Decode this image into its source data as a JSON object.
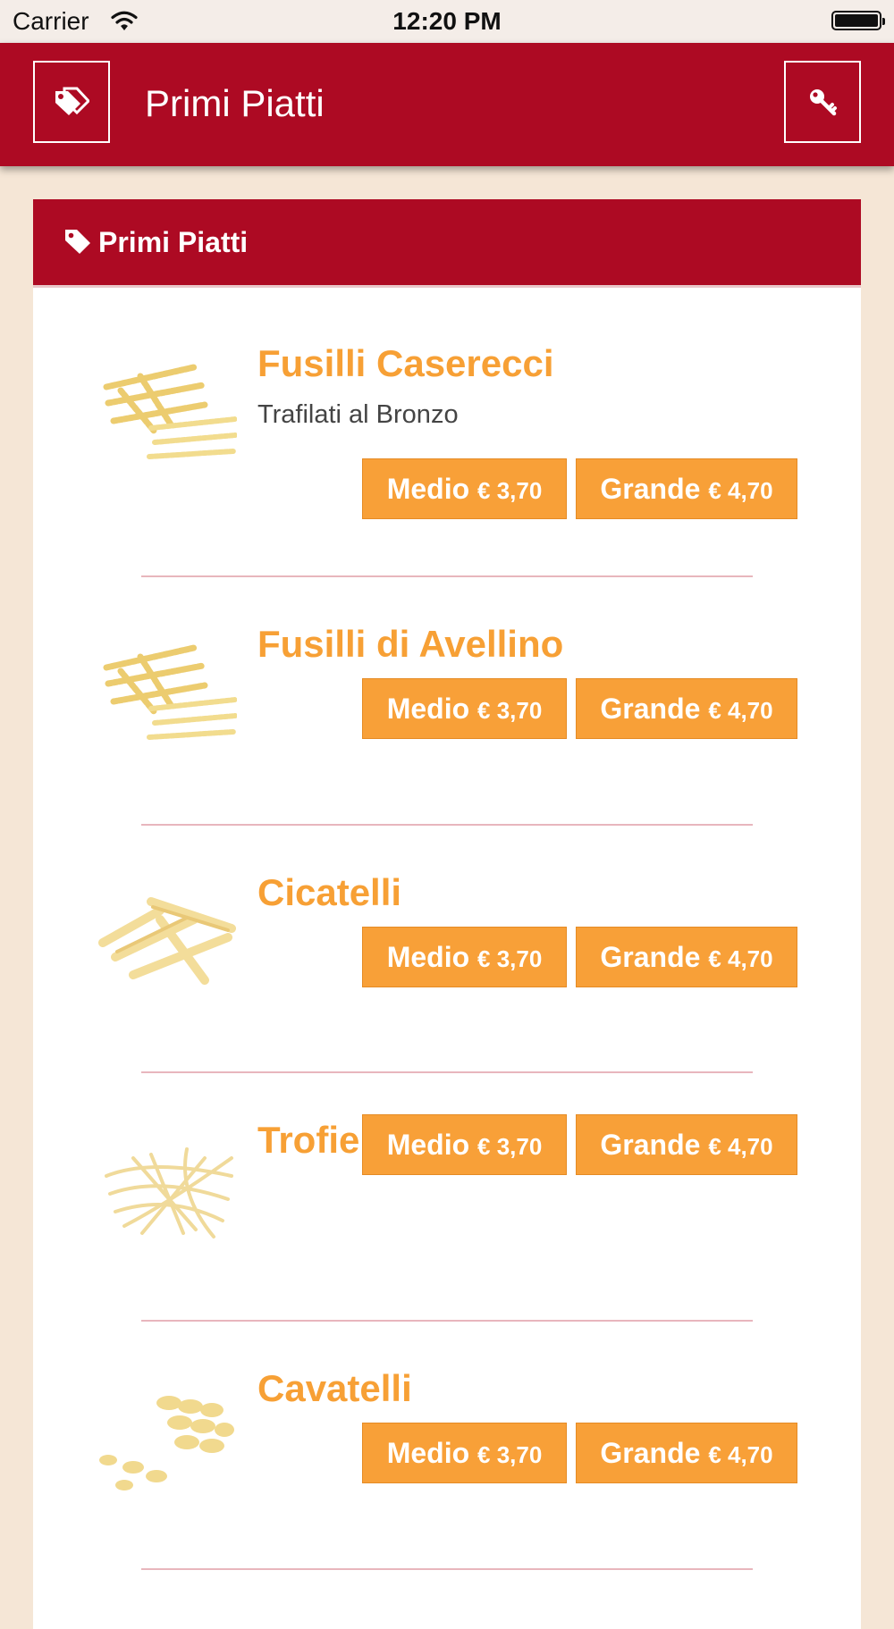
{
  "status_bar": {
    "carrier": "Carrier",
    "time": "12:20 PM"
  },
  "nav": {
    "title": "Primi Piatti",
    "left_icon": "tags-icon",
    "right_icon": "key-icon"
  },
  "section": {
    "title": "Primi Piatti",
    "icon": "tag-icon"
  },
  "items": [
    {
      "name": "Fusilli Caserecci",
      "description": "Trafilati al Bronzo",
      "medio_label": "Medio",
      "medio_price": "€ 3,70",
      "grande_label": "Grande",
      "grande_price": "€ 4,70",
      "image": "fusilli"
    },
    {
      "name": "Fusilli di Avellino",
      "description": "",
      "medio_label": "Medio",
      "medio_price": "€ 3,70",
      "grande_label": "Grande",
      "grande_price": "€ 4,70",
      "image": "fusilli"
    },
    {
      "name": "Cicatelli",
      "description": "",
      "medio_label": "Medio",
      "medio_price": "€ 3,70",
      "grande_label": "Grande",
      "grande_price": "€ 4,70",
      "image": "cicatelli"
    },
    {
      "name": "Trofie",
      "description": "",
      "medio_label": "Medio",
      "medio_price": "€ 3,70",
      "grande_label": "Grande",
      "grande_price": "€ 4,70",
      "image": "trofie"
    },
    {
      "name": "Cavatelli",
      "description": "",
      "medio_label": "Medio",
      "medio_price": "€ 3,70",
      "grande_label": "Grande",
      "grande_price": "€ 4,70",
      "image": "cavatelli"
    }
  ],
  "colors": {
    "brand_red": "#ad0a23",
    "accent_orange": "#f8a038",
    "background": "#f5e6d6"
  }
}
